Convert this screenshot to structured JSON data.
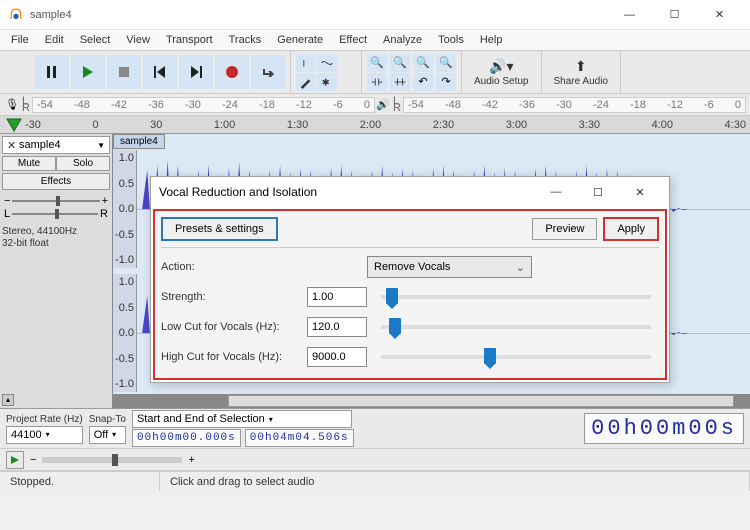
{
  "titlebar": {
    "title": "sample4"
  },
  "menu": {
    "items": [
      "File",
      "Edit",
      "Select",
      "View",
      "Transport",
      "Tracks",
      "Generate",
      "Effect",
      "Analyze",
      "Tools",
      "Help"
    ]
  },
  "toolbar": {
    "audio_setup_label": "Audio Setup",
    "share_audio_label": "Share Audio"
  },
  "meter_ticks": [
    "-54",
    "-48",
    "-42",
    "-36",
    "-30",
    "-24",
    "-18",
    "-12",
    "-6",
    "0"
  ],
  "timeline_ticks": [
    "-30",
    "0",
    "30",
    "1:00",
    "1:30",
    "2:00",
    "2:30",
    "3:00",
    "3:30",
    "4:00",
    "4:30"
  ],
  "track": {
    "name": "sample4",
    "clip_label": "sample4",
    "mute": "Mute",
    "solo": "Solo",
    "effects": "Effects",
    "pan_left": "L",
    "pan_right": "R",
    "info": "Stereo, 44100Hz\n32-bit float",
    "amp_ticks": [
      "1.0",
      "0.5",
      "0.0",
      "-0.5",
      "-1.0"
    ]
  },
  "dialog": {
    "title": "Vocal Reduction and Isolation",
    "presets_btn": "Presets & settings",
    "preview_btn": "Preview",
    "apply_btn": "Apply",
    "action_label": "Action:",
    "action_value": "Remove Vocals",
    "strength_label": "Strength:",
    "strength_value": "1.00",
    "lowcut_label": "Low Cut for Vocals (Hz):",
    "lowcut_value": "120.0",
    "highcut_label": "High Cut for Vocals (Hz):",
    "highcut_value": "9000.0"
  },
  "selection": {
    "project_rate_label": "Project Rate (Hz)",
    "project_rate_value": "44100",
    "snap_label": "Snap-To",
    "snap_value": "Off",
    "selection_label": "Start and End of Selection",
    "start_time": "00h00m00.000s",
    "end_time": "00h04m04.506s",
    "position_time": "00h00m00s"
  },
  "status": {
    "state": "Stopped.",
    "hint": "Click and drag to select audio"
  }
}
